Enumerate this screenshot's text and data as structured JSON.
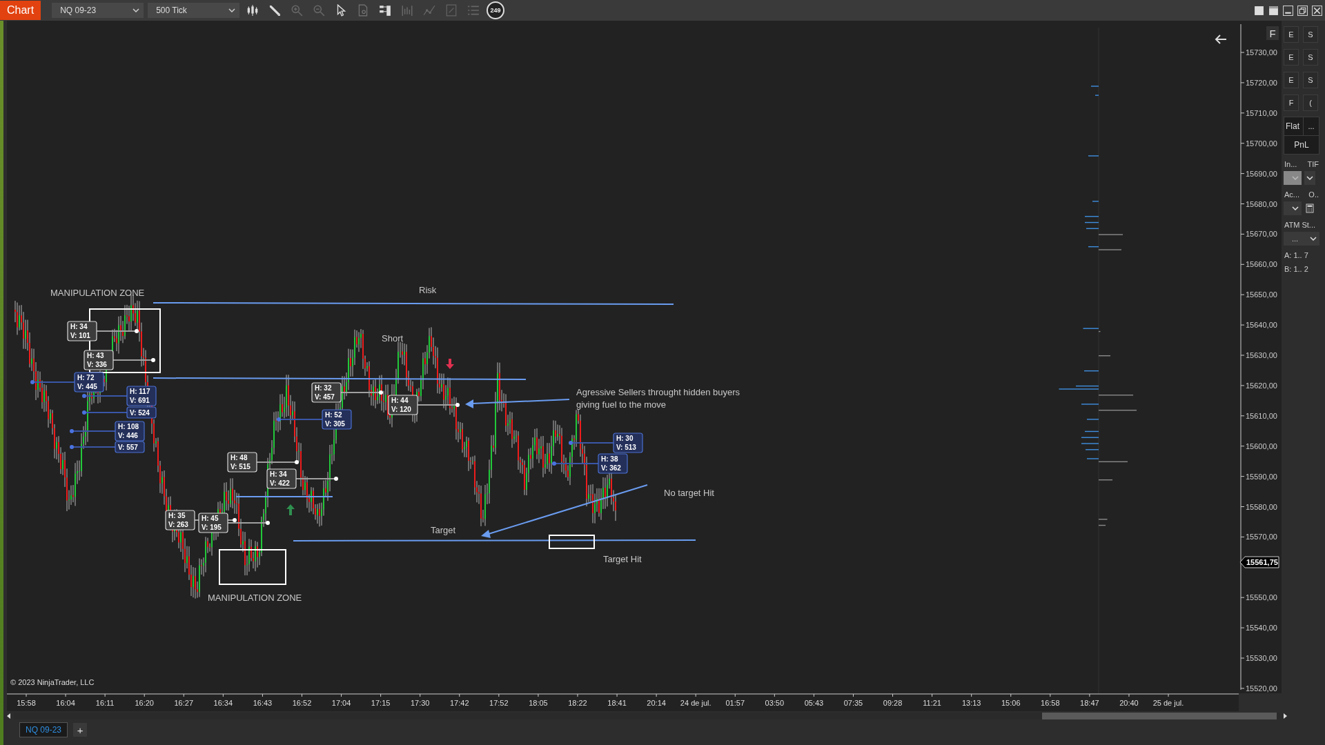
{
  "toolbar": {
    "title": "Chart",
    "instrument": "NQ 09-23",
    "interval": "500 Tick",
    "bar_count": "249"
  },
  "chart": {
    "scale_button": "F",
    "y_axis_labels": [
      "15730,00",
      "15720,00",
      "15710,00",
      "15700,00",
      "15690,00",
      "15680,00",
      "15670,00",
      "15660,00",
      "15650,00",
      "15640,00",
      "15630,00",
      "15620,00",
      "15610,00",
      "15600,00",
      "15590,00",
      "15580,00",
      "15570,00",
      "15550,00",
      "15540,00",
      "15530,00",
      "15520,00"
    ],
    "current_price": "15561,75",
    "x_axis_labels": [
      "15:58",
      "16:04",
      "16:11",
      "16:20",
      "16:27",
      "16:34",
      "16:43",
      "16:52",
      "17:04",
      "17:15",
      "17:30",
      "17:42",
      "17:52",
      "18:05",
      "18:22",
      "18:41",
      "20:14",
      "24 de jul.",
      "01:57",
      "03:50",
      "05:43",
      "07:35",
      "09:28",
      "11:21",
      "13:13",
      "15:06",
      "16:58",
      "18:47",
      "20:40",
      "25 de jul."
    ],
    "copyright": "© 2023 NinjaTrader, LLC",
    "annotations": [
      {
        "text": "MANIPULATION ZONE"
      },
      {
        "text": "Risk"
      },
      {
        "text": "Short"
      },
      {
        "text": "Agressive Sellers throught hidden buyers",
        "text2": "giving fuel to the move"
      },
      {
        "text": "No target Hit"
      },
      {
        "text": "Target"
      },
      {
        "text": "Target Hit"
      },
      {
        "text": "MANIPULATION ZONE"
      }
    ],
    "order_flow_labels": [
      {
        "kind": "grey",
        "h": "H: 34",
        "v": "V: 101"
      },
      {
        "kind": "grey",
        "h": "H: 43",
        "v": "V: 336"
      },
      {
        "kind": "grey",
        "h": "H: 32",
        "v": "V: 457"
      },
      {
        "kind": "grey",
        "h": "H: 48",
        "v": "V: 515"
      },
      {
        "kind": "grey",
        "h": "H: 34",
        "v": "V: 422"
      },
      {
        "kind": "grey",
        "h": "H: 35",
        "v": "V: 263"
      },
      {
        "kind": "grey",
        "h": "H: 45",
        "v": "V: 195"
      },
      {
        "kind": "grey",
        "h": "H: 44",
        "v": "V: 120"
      },
      {
        "kind": "blue",
        "h": "H: 72",
        "v": "V: 445"
      },
      {
        "kind": "blue",
        "h": "H: 117",
        "v": "V: 691"
      },
      {
        "kind": "blue",
        "v": "V: 524"
      },
      {
        "kind": "blue",
        "h": "H: 108",
        "v": "V: 446"
      },
      {
        "kind": "blue",
        "v": "V: 557"
      },
      {
        "kind": "blue",
        "h": "H: 52",
        "v": "V: 305"
      },
      {
        "kind": "blue",
        "h": "H: 30",
        "v": "V: 513"
      },
      {
        "kind": "blue",
        "h": "H: 38",
        "v": "V: 362"
      }
    ]
  },
  "order_panel": {
    "buttons": [
      {
        "label": "E"
      },
      {
        "label": "S"
      },
      {
        "label": "E"
      },
      {
        "label": "S"
      },
      {
        "label": "E"
      },
      {
        "label": "S"
      },
      {
        "label": "F"
      },
      {
        "label": "("
      }
    ],
    "flat": "Flat",
    "more": "...",
    "pnl": "PnL",
    "instrument_label": "In...",
    "tif_label": "TIF",
    "account_label": "Ac...",
    "order_label": "O..",
    "atm_label": "ATM St...",
    "atm_value": "...",
    "ask": "A: 1.. 7",
    "bid": "B: 1.. 2"
  },
  "tabs": [
    {
      "label": "NQ 09-23",
      "selected": true
    }
  ],
  "add_tab": "+"
}
